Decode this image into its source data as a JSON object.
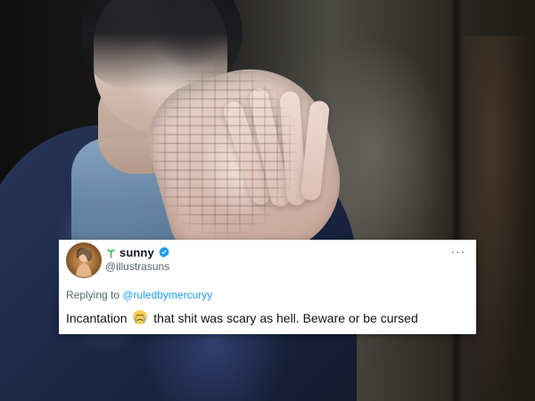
{
  "tweet": {
    "display_name": "sunny",
    "handle": "@illustrasuns",
    "more_label": "···",
    "replying_to_prefix": "Replying to ",
    "replying_to_handle": "@ruledbymercuryy",
    "text_before_emoji": "Incantation ",
    "text_after_emoji": " that shit was scary as hell. Beware or be cursed"
  },
  "colors": {
    "card_bg": "#ffffff",
    "text_primary": "#0f1419",
    "text_secondary": "#536471",
    "link": "#1d9bf0",
    "verified": "#1d9bf0"
  },
  "icons": {
    "sprout": "sprout-icon",
    "verified": "verified-badge-icon",
    "more": "more-icon",
    "emoji": "crying-face-emoji-icon"
  }
}
